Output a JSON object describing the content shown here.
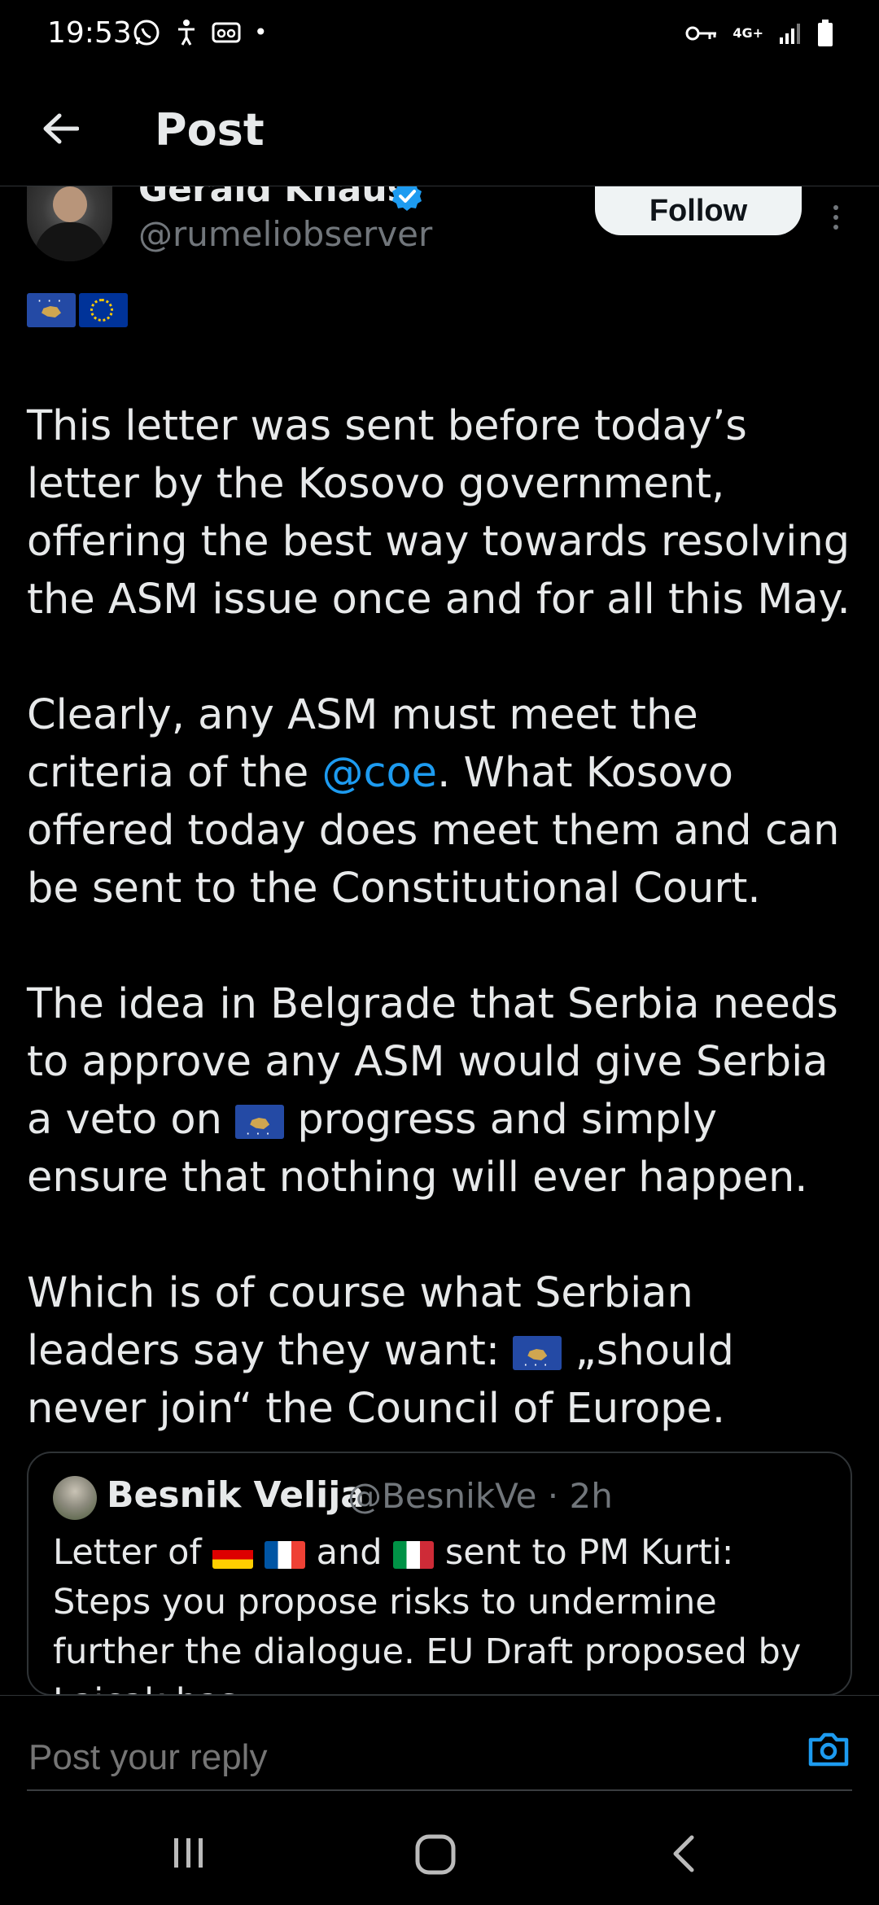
{
  "status_bar": {
    "time": "19:53",
    "network": "4G+"
  },
  "header": {
    "title": "Post"
  },
  "author": {
    "name": "Gerald Knaus",
    "handle": "@rumeliobserver",
    "verified": true,
    "follow_label": "Follow",
    "flags": [
      "kosovo",
      "eu"
    ]
  },
  "tweet": {
    "paragraph1": "This letter was sent before today’s letter by the Kosovo government, offering the best way towards resolving the ASM issue once and for all this May.",
    "paragraph2_before": "Clearly, any ASM must meet the criteria of the ",
    "paragraph2_mention": "@coe",
    "paragraph2_after": ". What Kosovo offered today does meet them and can be sent to the Constitutional Court.",
    "paragraph3_before": "The idea in Belgrade that Serbia needs to approve any ASM would give Serbia a veto on ",
    "paragraph3_after": " progress and simply ensure that nothing will ever happen.",
    "paragraph4_before": "Which is of course what Serbian leaders say they want: ",
    "paragraph4_after": " „should never join“ the Council of Europe."
  },
  "quote": {
    "name": "Besnik Velija",
    "meta": "@BesnikVe · 2h",
    "text_before": "Letter of ",
    "text_middle": " and ",
    "text_after": " sent to PM Kurti: Steps you propose risks to undermine further the dialogue. EU Draft proposed by Lajcak has"
  },
  "reply": {
    "placeholder": "Post your reply"
  },
  "colors": {
    "background": "#000000",
    "accent": "#1d9bf0",
    "text_primary": "#e7e9ea",
    "text_secondary": "#71767b"
  },
  "icons": {
    "back": "arrow-left-icon",
    "verified": "verified-badge-icon",
    "more": "vertical-ellipsis-icon",
    "camera": "camera-icon"
  }
}
